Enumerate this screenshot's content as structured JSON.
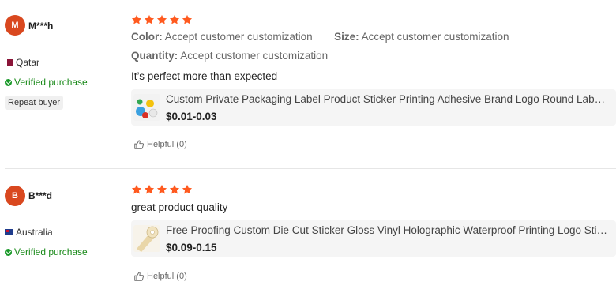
{
  "reviews": [
    {
      "avatar_initial": "M",
      "username": "M***h",
      "country": "Qatar",
      "verified": "Verified purchase",
      "badge": "Repeat buyer",
      "rating": 5,
      "attributes": {
        "color_key": "Color:",
        "color_value": "Accept customer customization",
        "size_key": "Size:",
        "size_value": "Accept customer customization",
        "quantity_key": "Quantity:",
        "quantity_value": "Accept customer customization"
      },
      "comment": "It’s perfect more than expected",
      "product": {
        "title": "Custom Private Packaging Label Product Sticker Printing Adhesive Brand Logo Round Label Stickers",
        "price": "$0.01-0.03"
      },
      "helpful": "Helpful (0)"
    },
    {
      "avatar_initial": "B",
      "username": "B***d",
      "country": "Australia",
      "verified": "Verified purchase",
      "rating": 5,
      "comment": "great product quality",
      "product": {
        "title": "Free Proofing Custom Die Cut Sticker Gloss Vinyl Holographic Waterproof Printing Logo Stickers",
        "price": "$0.09-0.15"
      },
      "helpful": "Helpful (0)"
    }
  ],
  "colors": {
    "avatar": "#d9481f",
    "star": "#ff5a1f",
    "verified": "#1a8a1a"
  }
}
